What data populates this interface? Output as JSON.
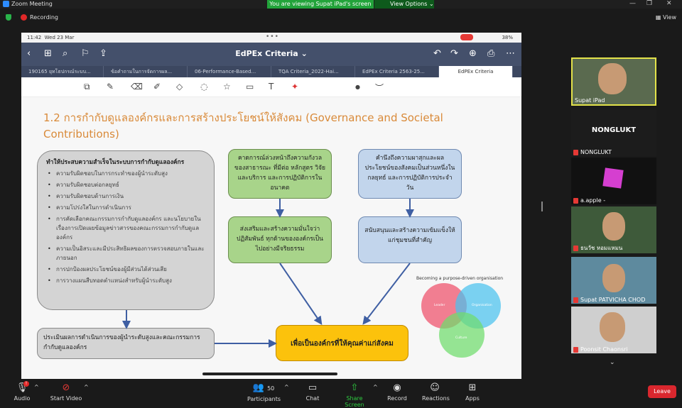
{
  "zoom": {
    "window_title": "Zoom Meeting",
    "viewing_banner": "You are viewing Supat iPad's screen",
    "view_options": "View Options",
    "recording": "Recording",
    "view": "View",
    "colors": {
      "accent_green": "#22a33a",
      "leave_red": "#d9272e"
    }
  },
  "ipad": {
    "status_time": "11:42",
    "status_date": "Wed 23 Mar",
    "battery": "38%",
    "doc_title": "EdPEx Criteria",
    "tabs": [
      "190165 ยุทโธปกรณ์ระบบ...",
      "ข้อคำถามในการจัดการผล...",
      "06-Performance-Based...",
      "TQA Criteria_2022-Hai...",
      "EdPEx Criteria 2563-25...",
      "EdPEx Criteria"
    ]
  },
  "slide": {
    "title": "1.2 การกำกับดูแลองค์กรและการสร้างประโยชน์ให้สังคม (Governance and Societal Contributions)",
    "gray_box": {
      "heading": "ทำให้ประสบความสำเร็จในระบบการกำกับดูแลองค์กร",
      "items": [
        "ความรับผิดชอบในการกระทำของผู้นำระดับสูง",
        "ความรับผิดชอบต่อกลยุทธ์",
        "ความรับผิดชอบด้านการเงิน",
        "ความโปร่งใสในการดำเนินการ",
        "การคัดเลือกคณะกรรมการกำกับดูแลองค์กร และนโยบายในเรื่องการเปิดเผยข้อมูลข่าวสารของคณะกรรมการกำกับดูแลองค์กร",
        "ความเป็นอิสระและมีประสิทธิผลของการตรวจสอบภายในและภายนอก",
        "การปกป้องผลประโยชน์ของผู้มีส่วนได้ส่วนเสีย",
        "การวางแผนสืบทอดตำแหน่งสำหรับผู้นำระดับสูง"
      ]
    },
    "green_top": "คาดการณ์ล่วงหน้าถึงความกังวลของสาธารณะ ที่มีต่อ หลักสูตร วิจัย และบริการ และการปฏิบัติการในอนาคต",
    "green_bottom": "ส่งเสริมและสร้างความมั่นใจว่าปฏิสัมพันธ์ ทุกด้านขององค์กรเป็นไปอย่างมีจริยธรรม",
    "blue_top": "คำนึงถึงความผาสุกและผลประโยชน์ของสังคมเป็นส่วนหนึ่งในกลยุทธ์ และการปฏิบัติการประจำวัน",
    "blue_bottom": "สนับสนุนและสร้างความเข้มแข็งให้แก่ชุมชนที่สำคัญ",
    "gray_bottom": "ประเมินผลการดำเนินการของผู้นำระดับสูงและคณะกรรมการกำกับดูแลองค์กร",
    "gold": "เพื่อเป็นองค์กรที่ให้คุณค่าแก่สังคม",
    "venn_title": "Becoming a purpose-driven organisation",
    "venn_labels": [
      "Leader",
      "Organisation",
      "Culture"
    ]
  },
  "participants": [
    {
      "name": "Supat iPad"
    },
    {
      "name": "NONGLUKT",
      "label": "NONGLUKT"
    },
    {
      "name": "a.apple -"
    },
    {
      "name": "ธนวัช หอมแหมน"
    },
    {
      "name": "Supat PATVICHA CHOD"
    },
    {
      "name": "Poonsit Chaonsri"
    }
  ],
  "controls": {
    "audio": "Audio",
    "video": "Start Video",
    "participants": "Participants",
    "participants_count": "50",
    "chat": "Chat",
    "share": "Share Screen",
    "record": "Record",
    "reactions": "Reactions",
    "apps": "Apps",
    "leave": "Leave",
    "audio_badge": "!"
  }
}
